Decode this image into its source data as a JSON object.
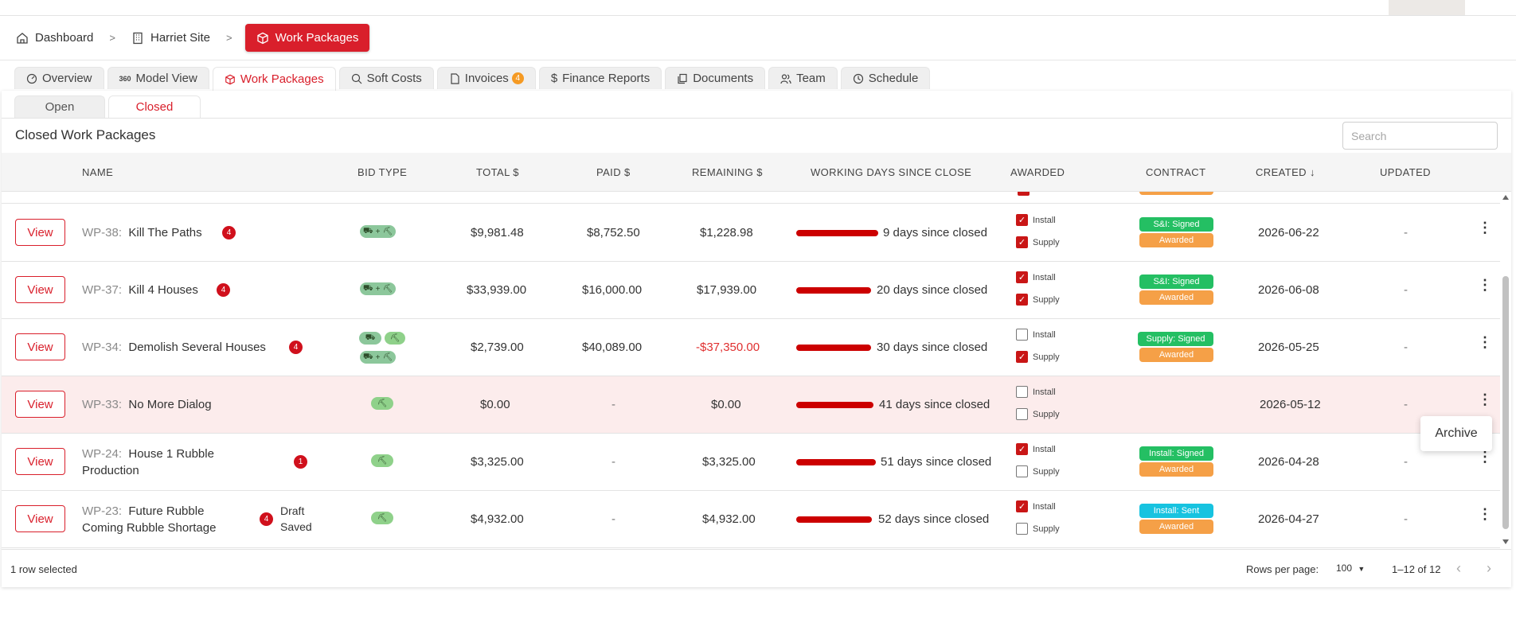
{
  "breadcrumb": {
    "dashboard": "Dashboard",
    "site": "Harriet Site",
    "current": "Work Packages",
    "separator": ">"
  },
  "tabs": [
    {
      "label": "Overview",
      "icon": "speed-icon"
    },
    {
      "label": "Model View",
      "icon": "360-icon"
    },
    {
      "label": "Work Packages",
      "icon": "cube-icon"
    },
    {
      "label": "Soft Costs",
      "icon": "search-dollar-icon"
    },
    {
      "label": "Invoices",
      "icon": "file-icon",
      "badge": "4"
    },
    {
      "label": "Finance Reports",
      "icon": "dollar-icon"
    },
    {
      "label": "Documents",
      "icon": "documents-icon"
    },
    {
      "label": "Team",
      "icon": "team-icon"
    },
    {
      "label": "Schedule",
      "icon": "schedule-icon"
    }
  ],
  "subtabs": {
    "open": "Open",
    "closed": "Closed"
  },
  "section_title": "Closed Work Packages",
  "search_placeholder": "Search",
  "columns": {
    "name": "NAME",
    "bid_type": "BID TYPE",
    "total": "TOTAL $",
    "paid": "PAID $",
    "remaining": "REMAINING $",
    "working_days": "WORKING DAYS SINCE CLOSE",
    "awarded": "AWARDED",
    "contract": "CONTRACT",
    "created": "CREATED ↓",
    "updated": "UPDATED"
  },
  "view_label": "View",
  "install_label": "Install",
  "supply_label": "Supply",
  "rows": [
    {
      "id": "WP-38:",
      "name1": "Kill The Paths",
      "name2": "",
      "badge": "4",
      "draft1": "",
      "draft2": "",
      "total": "$9,981.48",
      "paid": "$8,752.50",
      "remaining": "$1,228.98",
      "days": "9 days since closed",
      "install": true,
      "supply": true,
      "contract": "S&I: Signed",
      "contract_color": "#24bf63",
      "awarded": "Awarded",
      "created": "2026-06-22",
      "updated": "-"
    },
    {
      "id": "WP-37:",
      "name1": "Kill 4 Houses",
      "name2": "",
      "badge": "4",
      "draft1": "",
      "draft2": "",
      "total": "$33,939.00",
      "paid": "$16,000.00",
      "remaining": "$17,939.00",
      "days": "20 days since closed",
      "install": true,
      "supply": true,
      "contract": "S&I: Signed",
      "contract_color": "#24bf63",
      "awarded": "Awarded",
      "created": "2026-06-08",
      "updated": "-"
    },
    {
      "id": "WP-34:",
      "name1": "Demolish Several Houses",
      "name2": "",
      "badge": "4",
      "draft1": "",
      "draft2": "",
      "total": "$2,739.00",
      "paid": "$40,089.00",
      "remaining": "-$37,350.00",
      "days": "30 days since closed",
      "install": false,
      "supply": true,
      "contract": "Supply: Signed",
      "contract_color": "#24bf63",
      "awarded": "Awarded",
      "created": "2026-05-25",
      "updated": "-"
    },
    {
      "id": "WP-33:",
      "name1": "No More Dialog",
      "name2": "",
      "badge": "",
      "draft1": "",
      "draft2": "",
      "total": "$0.00",
      "paid": "-",
      "remaining": "$0.00",
      "days": "41 days since closed",
      "install": false,
      "supply": false,
      "contract": "",
      "contract_color": "",
      "awarded": "",
      "created": "2026-05-12",
      "updated": "-"
    },
    {
      "id": "WP-24:",
      "name1": "House 1 Rubble",
      "name2": "Production",
      "badge": "1",
      "draft1": "",
      "draft2": "",
      "total": "$3,325.00",
      "paid": "-",
      "remaining": "$3,325.00",
      "days": "51 days since closed",
      "install": true,
      "supply": false,
      "contract": "Install: Signed",
      "contract_color": "#24bf63",
      "awarded": "Awarded",
      "created": "2026-04-28",
      "updated": "-"
    },
    {
      "id": "WP-23:",
      "name1": "Future Rubble",
      "name2": "Coming Rubble Shortage",
      "badge": "4",
      "draft1": "Draft",
      "draft2": "Saved",
      "total": "$4,932.00",
      "paid": "-",
      "remaining": "$4,932.00",
      "days": "52 days since closed",
      "install": true,
      "supply": false,
      "contract": "Install: Sent",
      "contract_color": "#17c3e0",
      "awarded": "Awarded",
      "created": "2026-04-27",
      "updated": "-"
    }
  ],
  "colors": {
    "accent": "#d91f2b",
    "awarded": "#f5a047",
    "negative": "#e03030"
  },
  "footer": {
    "selected": "1 row selected",
    "rows_per_page_label": "Rows per page:",
    "rows_per_page": "100",
    "range": "1–12 of 12"
  },
  "context_menu": {
    "archive": "Archive"
  }
}
